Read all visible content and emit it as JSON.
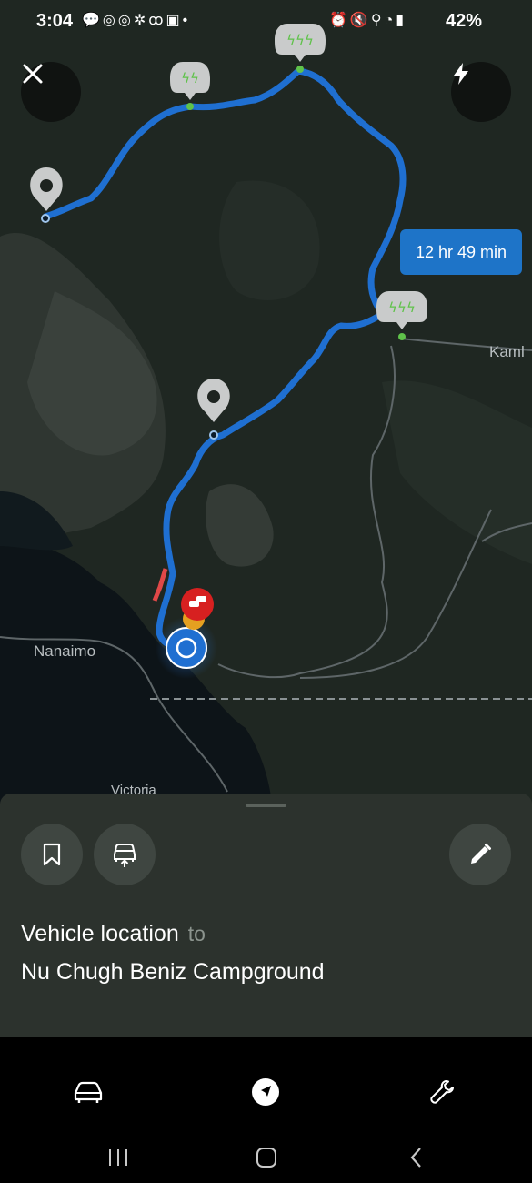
{
  "status_bar": {
    "time": "3:04",
    "battery": "42%",
    "left_icons": "💬◎◎✲ꝏ▣•",
    "right_icons": "⏰🔇⚲◔▮"
  },
  "map": {
    "close_icon": "close-icon",
    "charge_icon": "lightning-icon",
    "cities": [
      "Nanaimo",
      "Kaml",
      "Victoria"
    ],
    "trip_duration": "12 hr 49 min",
    "colors": {
      "route": "#1f6fd1",
      "duration_bg": "#1e74c8",
      "traffic_marker": "#d72020",
      "charger_glyph": "#5fc24a"
    }
  },
  "sheet": {
    "origin": "Vehicle location",
    "connector": "to",
    "destination": "Nu Chugh Beniz Campground"
  },
  "bottom_nav": {
    "items": [
      "car-icon",
      "navigation-icon",
      "wrench-icon"
    ]
  },
  "system_nav": {
    "items": [
      "recents-icon",
      "home-icon",
      "back-icon"
    ]
  }
}
